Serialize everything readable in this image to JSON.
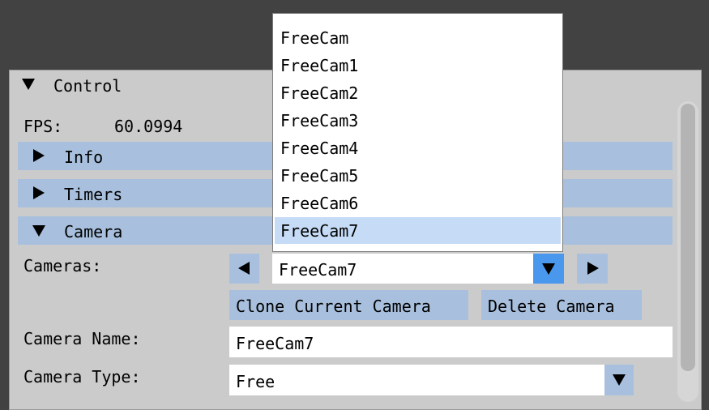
{
  "panel": {
    "title": "Control",
    "fps_label": "FPS:",
    "fps_value": "60.0994"
  },
  "sections": {
    "info": "Info",
    "timers": "Timers",
    "camera": "Camera"
  },
  "camera": {
    "cameras_label": "Cameras:",
    "selected_camera": "FreeCam7",
    "clone_button": "Clone Current Camera",
    "delete_button": "Delete Camera",
    "name_label": "Camera Name:",
    "name_value": "FreeCam7",
    "type_label": "Camera Type:",
    "type_value": "Free"
  },
  "dropdown": {
    "options": [
      "FreeCam",
      "FreeCam1",
      "FreeCam2",
      "FreeCam3",
      "FreeCam4",
      "FreeCam5",
      "FreeCam6",
      "FreeCam7"
    ],
    "selected_index": 7
  },
  "icons": {
    "collapse": "triangle-down-icon",
    "expand": "triangle-right-icon",
    "prev": "arrow-left-icon",
    "next": "arrow-right-icon",
    "dropdown": "chevron-down-icon"
  },
  "colors": {
    "background": "#424242",
    "panel": "#cbcbcb",
    "header": "#a8c0de",
    "accent": "#4a98ee",
    "selection": "#c6dcf6"
  }
}
